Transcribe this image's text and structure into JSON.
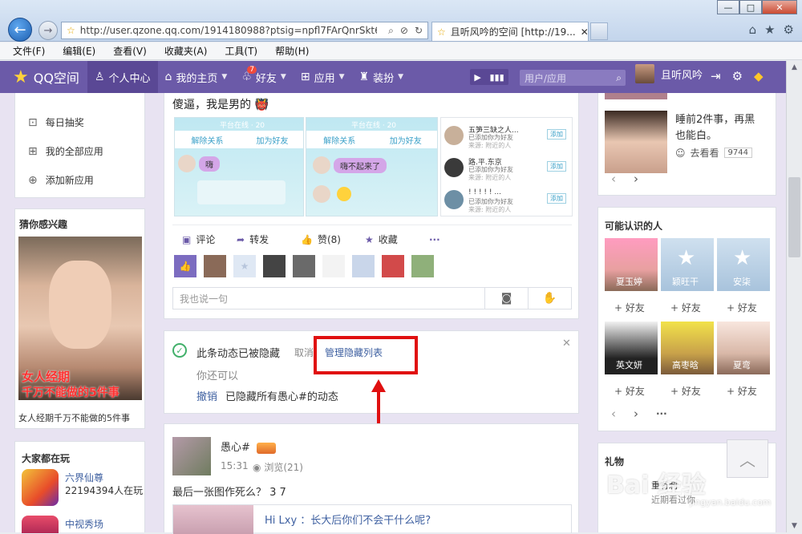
{
  "browser": {
    "url": "http://user.qzone.qq.com/1914180988?ptsig=npfl7FArQnrSkt6vsX",
    "tab_title": "且听风吟的空间 [http://19...",
    "window_buttons": [
      "—",
      "□",
      "✕"
    ]
  },
  "menu": [
    "文件(F)",
    "编辑(E)",
    "查看(V)",
    "收藏夹(A)",
    "工具(T)",
    "帮助(H)"
  ],
  "nav": {
    "logo": "QQ空间",
    "items": [
      {
        "label": "个人中心",
        "icon": "person-icon",
        "caret": false
      },
      {
        "label": "我的主页",
        "icon": "home-icon",
        "caret": true
      },
      {
        "label": "好友",
        "icon": "friends-icon",
        "caret": true,
        "badge": "7"
      },
      {
        "label": "应用",
        "icon": "grid-icon",
        "caret": true
      },
      {
        "label": "装扮",
        "icon": "shirt-icon",
        "caret": true
      }
    ],
    "search_placeholder": "用户/应用",
    "username": "且听风吟"
  },
  "left": {
    "menu_items": [
      "每日抽奖",
      "我的全部应用",
      "添加新应用"
    ],
    "interest": {
      "title": "猜你感兴趣",
      "overlay_line1": "女人经期",
      "overlay_line2": "千万不能做的5件事",
      "caption": "女人经期千万不能做的5件事"
    },
    "playing": {
      "title": "大家都在玩",
      "games": [
        {
          "name": "六界仙尊",
          "players": "22194394人在玩"
        },
        {
          "name": "中视秀场",
          "players": ""
        }
      ]
    }
  },
  "post1": {
    "text": "傻逼，我是男的",
    "emoji": "👹",
    "screens": [
      {
        "top": "平台在线 · 20",
        "tabs": [
          "解除关系",
          "加为好友"
        ],
        "bubble": "嗨"
      },
      {
        "top": "平台在线 · 20",
        "tabs": [
          "解除关系",
          "加为好友"
        ],
        "bubble": "嗨不起来了"
      },
      {
        "rows": [
          {
            "name": "五笋三缺之人...",
            "sub": "已添加你为好友",
            "src": "来源: 附近的人"
          },
          {
            "name": "路.平.东京",
            "sub": "已添加你为好友",
            "src": "来源: 附近的人"
          },
          {
            "name": "! ! ! ! ! ...",
            "sub": "已添加你为好友",
            "src": "来源: 附近的人"
          }
        ],
        "add": "添加"
      }
    ],
    "actions": [
      {
        "label": "评论",
        "icon": "comment-icon"
      },
      {
        "label": "转发",
        "icon": "share-icon"
      },
      {
        "label": "赞(8)",
        "icon": "like-icon"
      },
      {
        "label": "收藏",
        "icon": "star-icon"
      },
      {
        "label": "···",
        "icon": "more-icon"
      }
    ],
    "comment_placeholder": "我也说一句"
  },
  "hidden": {
    "status": "此条动态已被隐藏",
    "cancel": "取消",
    "manage": "管理隐藏列表",
    "hint": "你还可以",
    "undo": "撤销",
    "hide_all": "已隐藏所有愚心#的动态"
  },
  "post2": {
    "author": "愚心#",
    "time": "15:31",
    "views": "浏览(21)",
    "text": "最后一张图作死么？ 3 7",
    "quote": "Hi Lxy ：长大后你们不会干什么呢?"
  },
  "right": {
    "top_card": {
      "text": "睡前2件事，再黑也能白。",
      "look": "去看看",
      "count": "9744"
    },
    "people": {
      "title": "可能认识的人",
      "list": [
        {
          "name": "夏玉婷"
        },
        {
          "name": "颖旺干"
        },
        {
          "name": "安柒"
        },
        {
          "name": "英文妍"
        },
        {
          "name": "高枣晗"
        },
        {
          "name": "夏弯"
        }
      ],
      "add_label": "好友"
    },
    "gifts": {
      "title": "礼物",
      "sub1": "重有刺",
      "sub2": "近期看过你"
    }
  },
  "watermark": {
    "brand": "Bai 经验",
    "url": "jingyan.baidu.com"
  },
  "colors": {
    "nav": "#6b5aa8",
    "accent": "#e01010",
    "link": "#3d5fa0"
  }
}
